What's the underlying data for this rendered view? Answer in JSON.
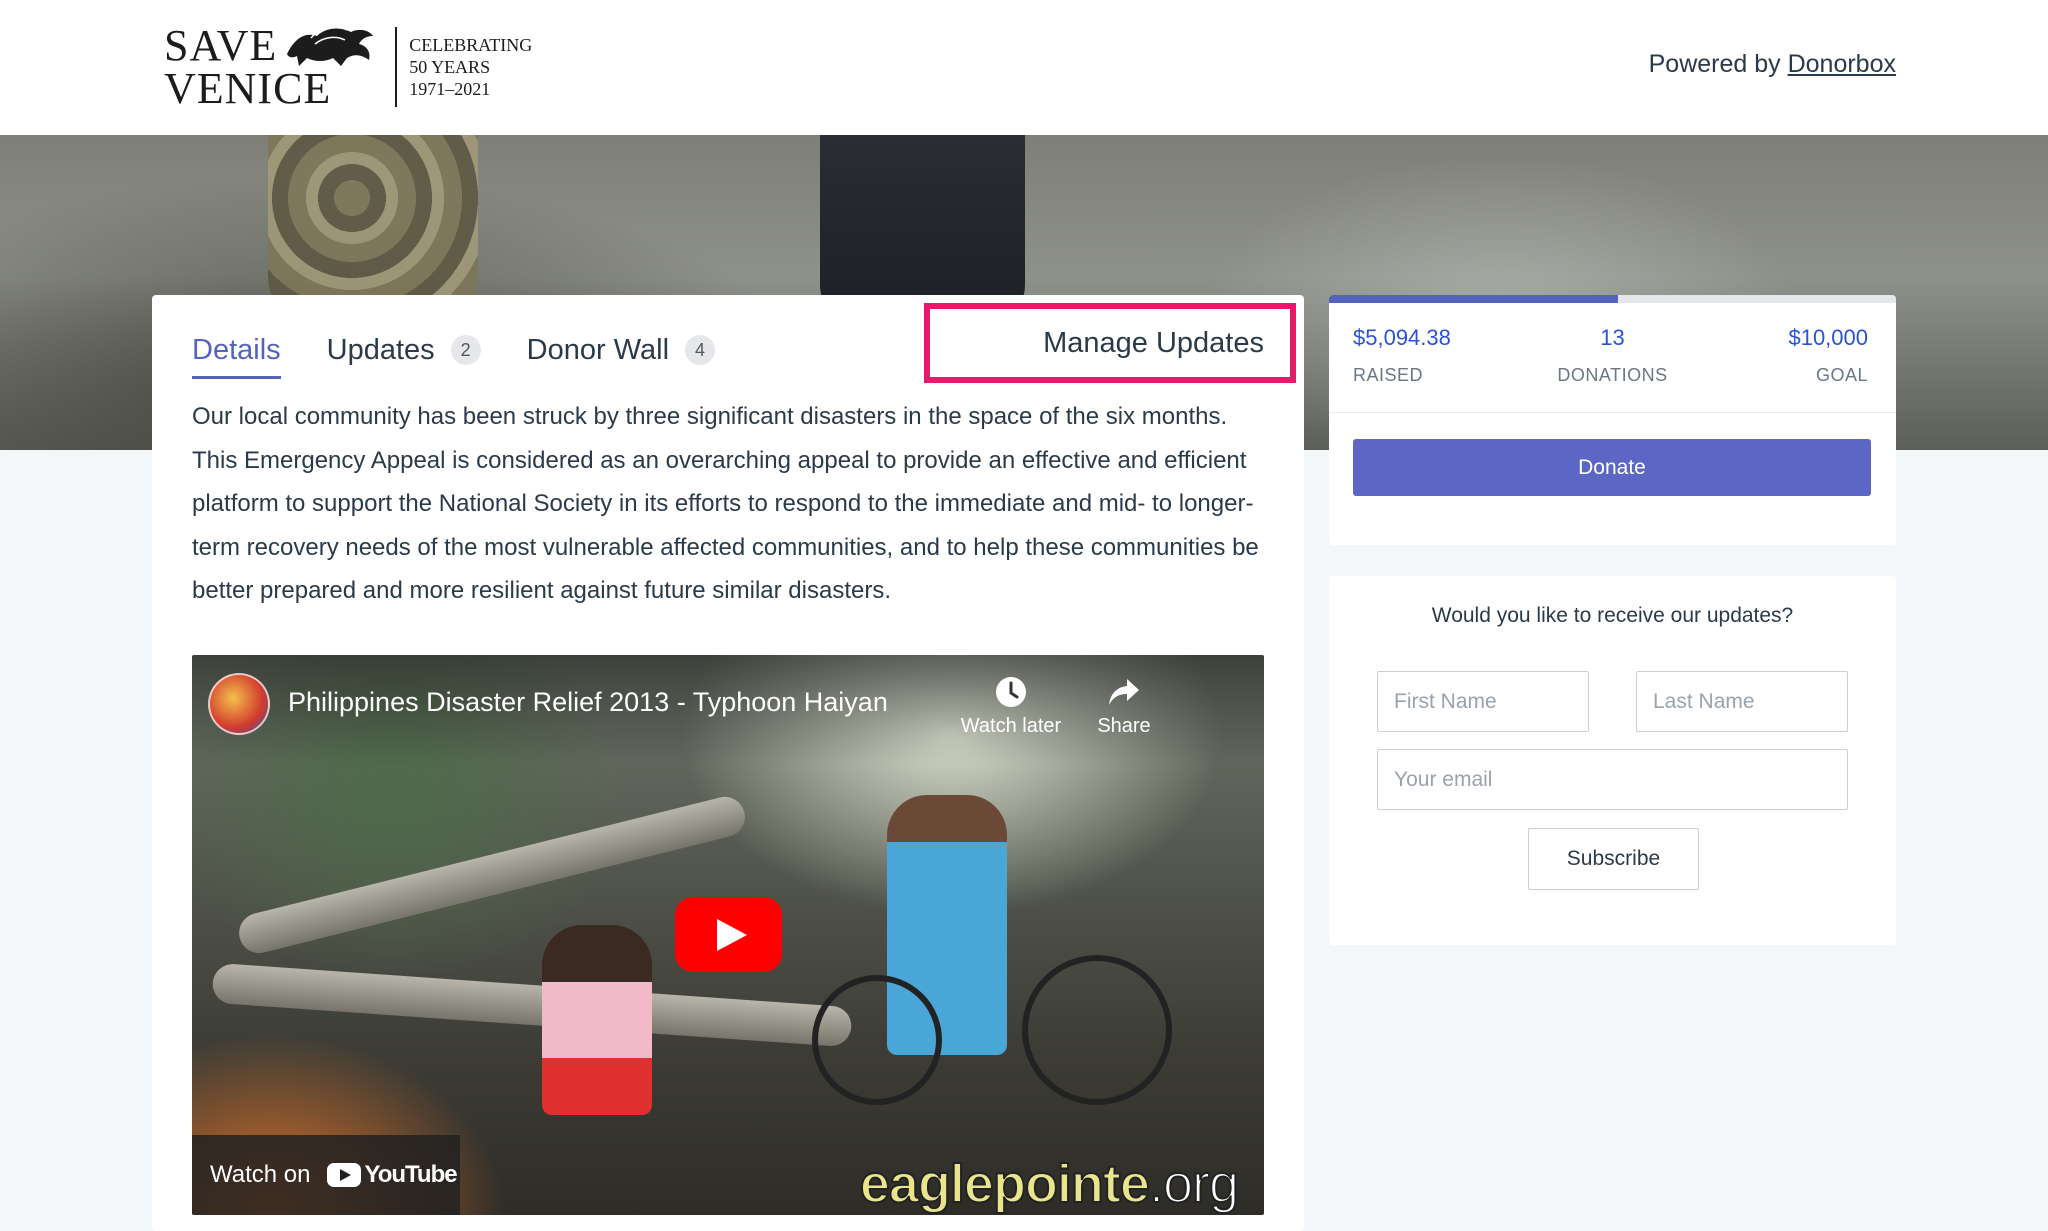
{
  "header": {
    "logo": {
      "line1": "SAVE",
      "line2": "VENICE",
      "tag1": "CELEBRATING",
      "tag2": "50 YEARS",
      "tag3": "1971–2021"
    },
    "powered_prefix": "Powered by",
    "powered_link": "Donorbox"
  },
  "tabs": [
    {
      "label": "Details",
      "active": true
    },
    {
      "label": "Updates",
      "badge": "2"
    },
    {
      "label": "Donor Wall",
      "badge": "4"
    }
  ],
  "manage_updates_label": "Manage Updates",
  "description": "Our local community has been struck by three significant disasters in the space of the six months. This Emergency Appeal is considered as an overarching appeal to provide an effective and efficient platform to support the National Society in its efforts to respond to the immediate and mid- to longer-term recovery needs of the most vulnerable affected communities, and to help these communities be better prepared and more resilient against future similar disasters.",
  "video": {
    "title": "Philippines Disaster Relief 2013 - Typhoon Haiyan",
    "watch_later": "Watch later",
    "share": "Share",
    "watch_on": "Watch on",
    "youtube": "YouTube",
    "watermark_main": "eaglepointe",
    "watermark_tld": ".org"
  },
  "stats": {
    "raised_value": "$5,094.38",
    "raised_label": "RAISED",
    "donations_value": "13",
    "donations_label": "DONATIONS",
    "goal_value": "$10,000",
    "goal_label": "GOAL",
    "progress_fraction": 0.509,
    "donate_label": "Donate"
  },
  "subscribe": {
    "title": "Would you like to receive our updates?",
    "first_name_placeholder": "First Name",
    "last_name_placeholder": "Last Name",
    "email_placeholder": "Your email",
    "button_label": "Subscribe"
  },
  "colors": {
    "accent": "#5463be",
    "highlight_border": "#e6196a",
    "stat_value": "#2a52d8",
    "youtube_red": "#ff0000"
  }
}
